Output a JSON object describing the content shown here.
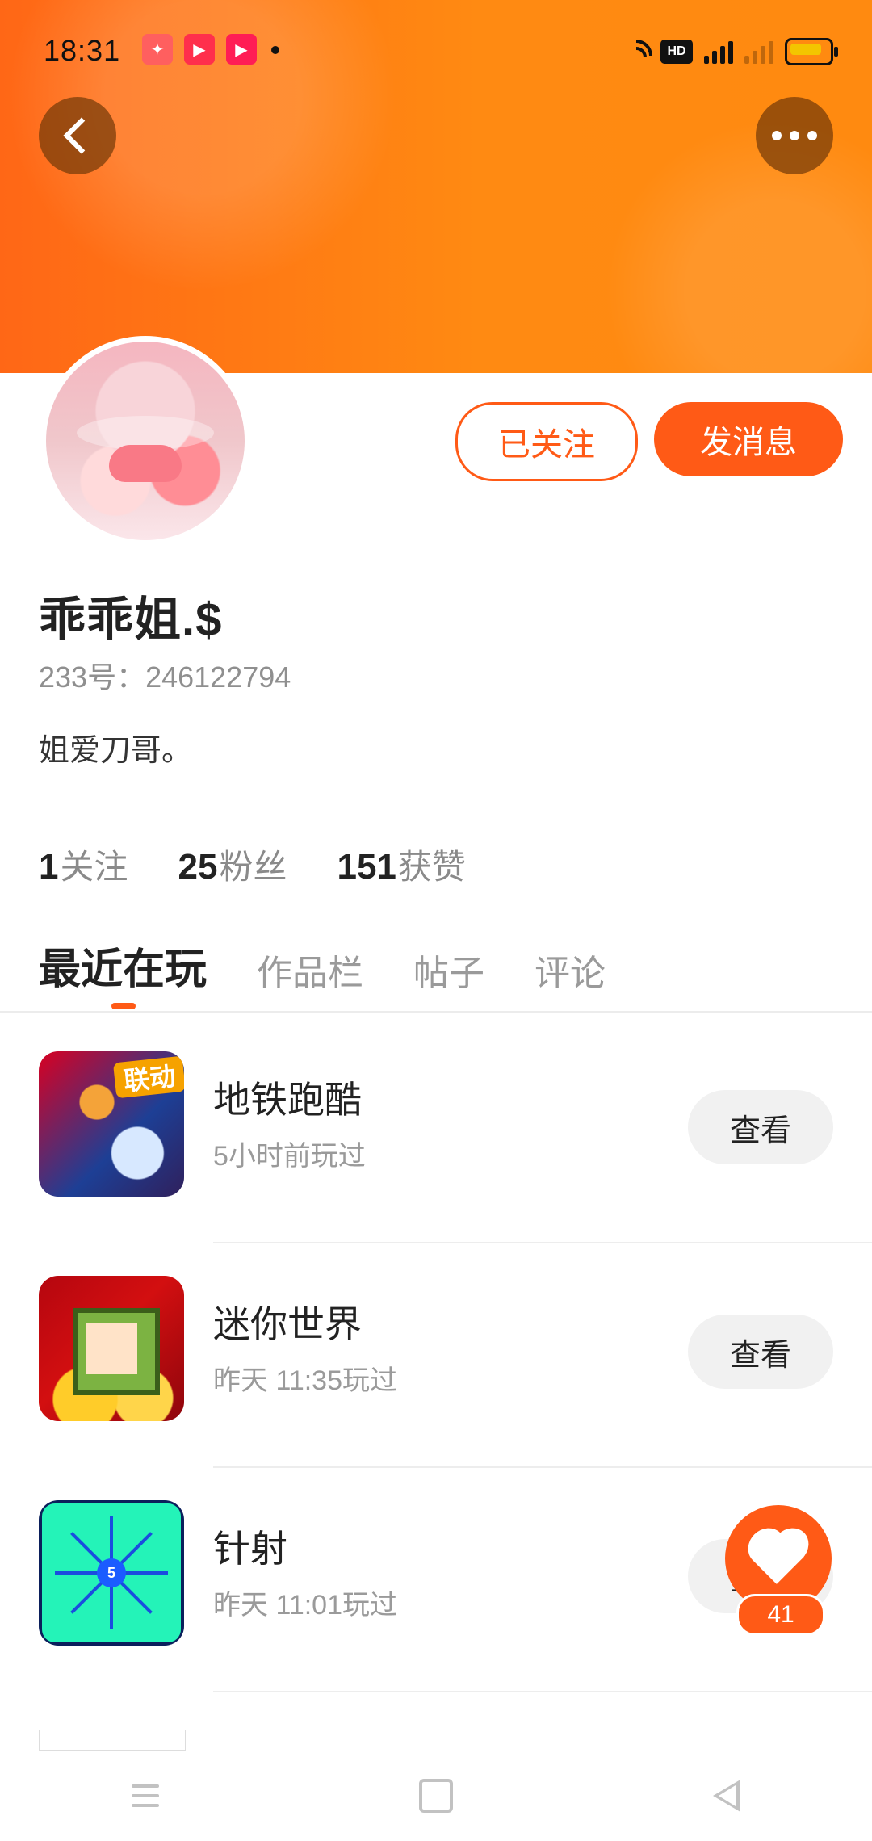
{
  "status": {
    "time": "18:31",
    "apps": [
      "video-app",
      "youtube-app",
      "video-app-2"
    ],
    "hd": "HD"
  },
  "profile": {
    "name": "乖乖姐.$",
    "id_line": "233号：246122794",
    "bio": "姐爱刀哥。",
    "follow_button": "已关注",
    "message_button": "发消息"
  },
  "stats": [
    {
      "value": "1",
      "label": "关注"
    },
    {
      "value": "25",
      "label": "粉丝"
    },
    {
      "value": "151",
      "label": "获赞"
    }
  ],
  "tabs": [
    {
      "label": "最近在玩"
    },
    {
      "label": "作品栏"
    },
    {
      "label": "帖子"
    },
    {
      "label": "评论"
    }
  ],
  "games": [
    {
      "title": "地铁跑酷",
      "meta": "5小时前玩过",
      "button": "查看",
      "badge": "联动"
    },
    {
      "title": "迷你世界",
      "meta": "昨天 11:35玩过",
      "button": "查看"
    },
    {
      "title": "针射",
      "meta": "昨天 11:01玩过",
      "button": "查看",
      "icon_number": "5"
    }
  ],
  "fab": {
    "count": "41"
  },
  "nav": {
    "menu": "menu-icon",
    "home": "square-icon",
    "back": "triangle-icon"
  },
  "colors": {
    "accent": "#ff5a16"
  }
}
